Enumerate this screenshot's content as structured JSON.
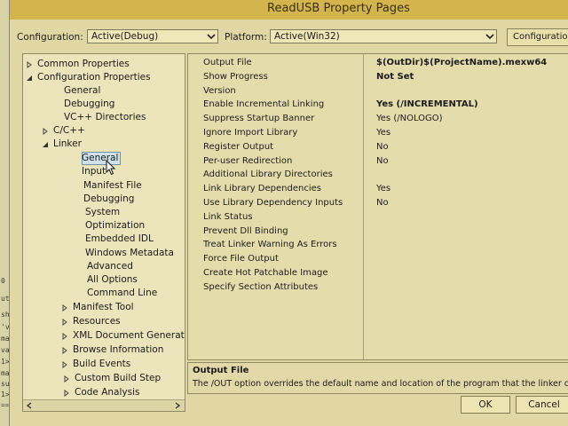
{
  "window": {
    "title": "ReadUSB Property Pages"
  },
  "config_bar": {
    "configuration_label": "Configuration:",
    "configuration_value": "Active(Debug)",
    "platform_label": "Platform:",
    "platform_value": "Active(Win32)",
    "configuration_manager_label": "Configuration M"
  },
  "tree": {
    "items": [
      {
        "label": "Common Properties",
        "arrow": "collapsed"
      },
      {
        "label": "Configuration Properties",
        "arrow": "expanded"
      },
      {
        "label": "General",
        "arrow": "none"
      },
      {
        "label": "Debugging",
        "arrow": "none"
      },
      {
        "label": "VC++ Directories",
        "arrow": "none"
      },
      {
        "label": "C/C++",
        "arrow": "collapsed"
      },
      {
        "label": "Linker",
        "arrow": "expanded"
      },
      {
        "label": "General",
        "arrow": "none",
        "selected": true
      },
      {
        "label": "Input",
        "arrow": "none"
      },
      {
        "label": "Manifest File",
        "arrow": "none"
      },
      {
        "label": "Debugging",
        "arrow": "none"
      },
      {
        "label": "System",
        "arrow": "none"
      },
      {
        "label": "Optimization",
        "arrow": "none"
      },
      {
        "label": "Embedded IDL",
        "arrow": "none"
      },
      {
        "label": "Windows Metadata",
        "arrow": "none"
      },
      {
        "label": "Advanced",
        "arrow": "none"
      },
      {
        "label": "All Options",
        "arrow": "none"
      },
      {
        "label": "Command Line",
        "arrow": "none"
      },
      {
        "label": "Manifest Tool",
        "arrow": "collapsed"
      },
      {
        "label": "Resources",
        "arrow": "collapsed"
      },
      {
        "label": "XML Document Generator",
        "arrow": "collapsed"
      },
      {
        "label": "Browse Information",
        "arrow": "collapsed"
      },
      {
        "label": "Build Events",
        "arrow": "collapsed"
      },
      {
        "label": "Custom Build Step",
        "arrow": "collapsed"
      },
      {
        "label": "Code Analysis",
        "arrow": "collapsed"
      }
    ]
  },
  "properties": [
    {
      "name": "Output File",
      "value": "$(OutDir)$(ProjectName).mexw64",
      "bold": true
    },
    {
      "name": "Show Progress",
      "value": "Not Set",
      "bold": true
    },
    {
      "name": "Version",
      "value": ""
    },
    {
      "name": "Enable Incremental Linking",
      "value": "Yes (/INCREMENTAL)",
      "bold": true
    },
    {
      "name": "Suppress Startup Banner",
      "value": "Yes (/NOLOGO)"
    },
    {
      "name": "Ignore Import Library",
      "value": "Yes"
    },
    {
      "name": "Register Output",
      "value": "No"
    },
    {
      "name": "Per-user Redirection",
      "value": "No"
    },
    {
      "name": "Additional Library Directories",
      "value": ""
    },
    {
      "name": "Link Library Dependencies",
      "value": "Yes"
    },
    {
      "name": "Use Library Dependency Inputs",
      "value": "No"
    },
    {
      "name": "Link Status",
      "value": ""
    },
    {
      "name": "Prevent Dll Binding",
      "value": ""
    },
    {
      "name": "Treat Linker Warning As Errors",
      "value": ""
    },
    {
      "name": "Force File Output",
      "value": ""
    },
    {
      "name": "Create Hot Patchable Image",
      "value": ""
    },
    {
      "name": "Specify Section Attributes",
      "value": ""
    }
  ],
  "description": {
    "title": "Output File",
    "text": "The /OUT option overrides the default name and location of the program that the linker creates."
  },
  "buttons": {
    "ok": "OK",
    "cancel": "Cancel"
  },
  "background_editor": {
    "lines": [
      "0 %",
      "utp",
      "sho",
      "'v",
      "ma",
      "va",
      "1><",
      "ma",
      "su",
      "1>|",
      "=="
    ]
  },
  "colors": {
    "selection_fill": "#cfe2ea",
    "selection_border": "#6f94a8",
    "titlebar": "#d4b44c"
  }
}
